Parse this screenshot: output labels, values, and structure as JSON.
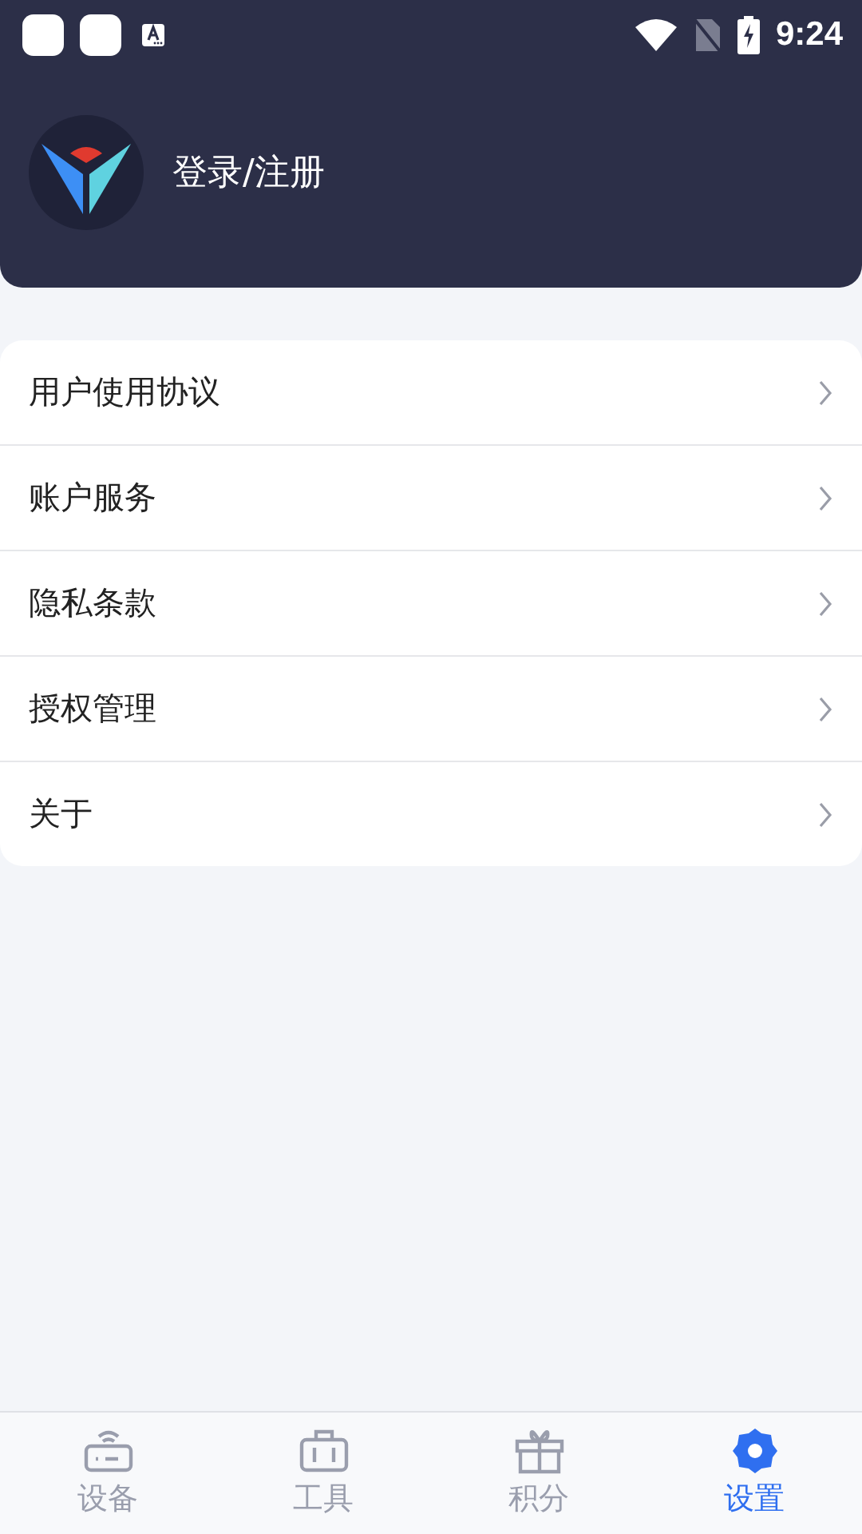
{
  "status_bar": {
    "time": "9:24"
  },
  "profile": {
    "login_label": "登录/注册"
  },
  "menu": [
    {
      "label": "用户使用协议"
    },
    {
      "label": "账户服务"
    },
    {
      "label": "隐私条款"
    },
    {
      "label": "授权管理"
    },
    {
      "label": "关于"
    }
  ],
  "tabs": [
    {
      "label": "设备",
      "kind": "router",
      "selected": false
    },
    {
      "label": "工具",
      "kind": "briefcase",
      "selected": false
    },
    {
      "label": "积分",
      "kind": "gift",
      "selected": false
    },
    {
      "label": "设置",
      "kind": "gear",
      "selected": true
    }
  ]
}
